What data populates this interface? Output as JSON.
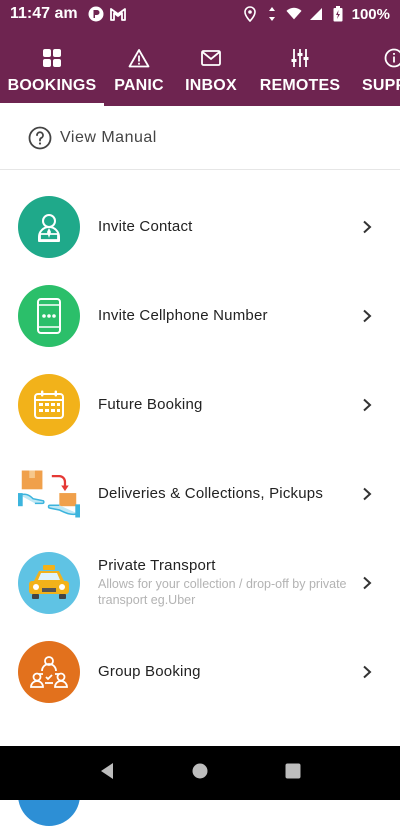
{
  "status": {
    "time": "11:47 am",
    "battery": "100%"
  },
  "tabs": [
    {
      "label": "BOOKINGS",
      "icon": "grid-icon",
      "active": true
    },
    {
      "label": "PANIC",
      "icon": "warning-icon",
      "active": false
    },
    {
      "label": "INBOX",
      "icon": "mail-icon",
      "active": false
    },
    {
      "label": "REMOTES",
      "icon": "sliders-icon",
      "active": false
    },
    {
      "label": "SUPPO",
      "icon": "info-icon",
      "active": false
    }
  ],
  "manual": {
    "label": "View Manual"
  },
  "list": [
    {
      "title": "Invite Contact",
      "subtitle": "",
      "icon": "contact-person-icon",
      "color": "#1fa98a"
    },
    {
      "title": "Invite Cellphone Number",
      "subtitle": "",
      "icon": "cellphone-icon",
      "color": "#2bbf6a"
    },
    {
      "title": "Future Booking",
      "subtitle": "",
      "icon": "calendar-icon",
      "color": "#f2b21a"
    },
    {
      "title": "Deliveries & Collections, Pickups",
      "subtitle": "",
      "icon": "delivery-box-icon",
      "color": "#ffffff"
    },
    {
      "title": "Private Transport",
      "subtitle": "Allows for your  collection / drop-off by private transport eg.Uber",
      "icon": "taxi-icon",
      "color": "#5fc3e4"
    },
    {
      "title": "Group Booking",
      "subtitle": "",
      "icon": "group-icon",
      "color": "#e2711d"
    }
  ],
  "colors": {
    "header": "#6e2450"
  }
}
